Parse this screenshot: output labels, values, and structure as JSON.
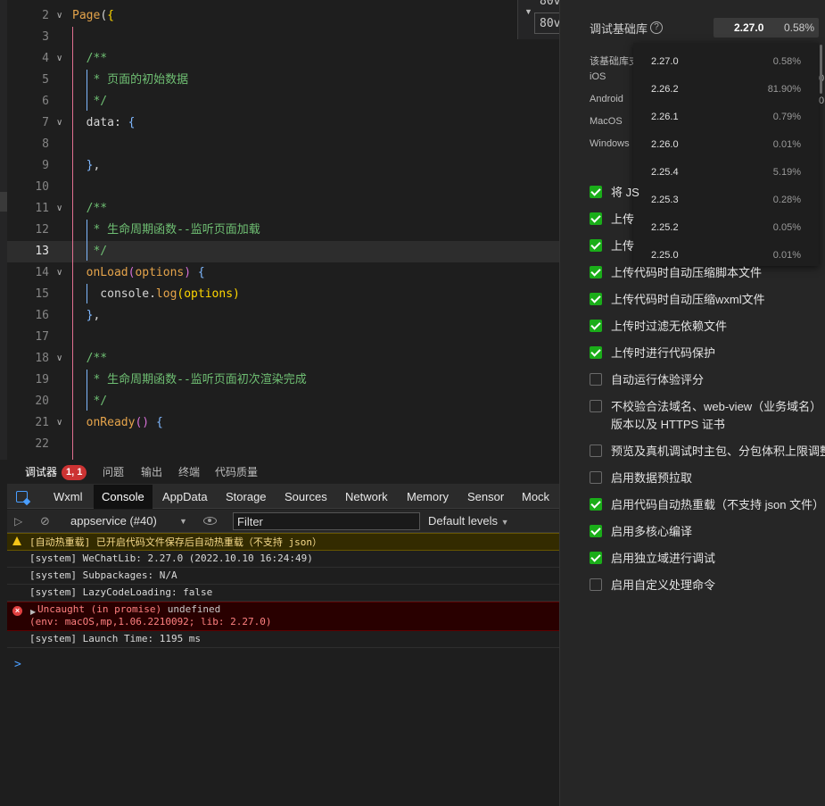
{
  "editor": {
    "lines": [
      {
        "num": "2",
        "fold": "chevron",
        "code": [
          [
            "Page",
            "kw"
          ],
          [
            "(",
            "brk"
          ],
          [
            "{",
            "ybr"
          ]
        ]
      },
      {
        "num": "3",
        "fold": "",
        "code": []
      },
      {
        "num": "4",
        "fold": "chevron",
        "code": [
          [
            "  /**",
            "cmt"
          ]
        ]
      },
      {
        "num": "5",
        "fold": "",
        "code": [
          [
            "   * 页面的初始数据",
            "cmt"
          ]
        ]
      },
      {
        "num": "6",
        "fold": "",
        "code": [
          [
            "   */",
            "cmt"
          ]
        ]
      },
      {
        "num": "7",
        "fold": "chevron",
        "code": [
          [
            "  data: ",
            "brk"
          ],
          [
            "{",
            "vbr"
          ]
        ]
      },
      {
        "num": "8",
        "fold": "",
        "code": []
      },
      {
        "num": "9",
        "fold": "",
        "code": [
          [
            "  ",
            "brk"
          ],
          [
            "}",
            "vbr"
          ],
          [
            ",",
            "brk"
          ]
        ]
      },
      {
        "num": "10",
        "fold": "",
        "code": []
      },
      {
        "num": "11",
        "fold": "chevron",
        "code": [
          [
            "  /**",
            "cmt"
          ]
        ]
      },
      {
        "num": "12",
        "fold": "",
        "code": [
          [
            "   * 生命周期函数--监听页面加载",
            "cmt"
          ]
        ]
      },
      {
        "num": "13",
        "fold": "",
        "code": [
          [
            "   */",
            "cmt"
          ]
        ],
        "active": true
      },
      {
        "num": "14",
        "fold": "chevron",
        "code": [
          [
            "  onLoad",
            "kw"
          ],
          [
            "(",
            "pbr"
          ],
          [
            "options",
            "arg"
          ],
          [
            ")",
            "pbr"
          ],
          [
            " ",
            "brk"
          ],
          [
            "{",
            "vbr"
          ]
        ]
      },
      {
        "num": "15",
        "fold": "",
        "code": [
          [
            "    console.",
            "brk"
          ],
          [
            "log",
            "kw"
          ],
          [
            "(options)",
            "ybr"
          ]
        ]
      },
      {
        "num": "16",
        "fold": "",
        "code": [
          [
            "  ",
            "brk"
          ],
          [
            "}",
            "vbr"
          ],
          [
            ",",
            "brk"
          ]
        ]
      },
      {
        "num": "17",
        "fold": "",
        "code": []
      },
      {
        "num": "18",
        "fold": "chevron",
        "code": [
          [
            "  /**",
            "cmt"
          ]
        ]
      },
      {
        "num": "19",
        "fold": "",
        "code": [
          [
            "   * 生命周期函数--监听页面初次渲染完成",
            "cmt"
          ]
        ]
      },
      {
        "num": "20",
        "fold": "",
        "code": [
          [
            "   */",
            "cmt"
          ]
        ]
      },
      {
        "num": "21",
        "fold": "chevron",
        "code": [
          [
            "  onReady",
            "kw"
          ],
          [
            "() ",
            "pbr"
          ],
          [
            "{",
            "vbr"
          ]
        ]
      },
      {
        "num": "22",
        "fold": "",
        "code": []
      }
    ],
    "tooltip": {
      "line1": "80v",
      "line2": "80v"
    }
  },
  "panel_tabs": [
    {
      "label": "调试器",
      "active": true
    },
    {
      "label": "问题"
    },
    {
      "label": "输出"
    },
    {
      "label": "终端"
    },
    {
      "label": "代码质量"
    }
  ],
  "debugger_badge": "1, 1",
  "devtools_tabs": [
    "Wxml",
    "Console",
    "AppData",
    "Storage",
    "Sources",
    "Network",
    "Memory",
    "Sensor",
    "Mock"
  ],
  "devtools_active_tab": "Console",
  "filterbar": {
    "context": "appservice (#40)",
    "filter_placeholder": "Filter",
    "levels": "Default levels"
  },
  "console": {
    "warning": "[自动热重载] 已开启代码文件保存后自动热重载（不支持 json）",
    "messages": [
      "[system] WeChatLib: 2.27.0 (2022.10.10 16:24:49)",
      "[system] Subpackages: N/A",
      "[system] LazyCodeLoading: false"
    ],
    "error_line1": "Uncaught (in promise)",
    "error_line1_suffix": " undefined",
    "error_line2": "(env: macOS,mp,1.06.2210092; lib: 2.27.0)",
    "launch": "[system] Launch Time: 1195 ms",
    "prompt": ">"
  },
  "settings": {
    "title": "调试基础库",
    "help": "?",
    "selected_version": "2.27.0",
    "selected_percent": "0.58%",
    "info_label": "该基础库支",
    "platforms": [
      "iOS",
      "Android",
      "MacOS",
      "Windows"
    ],
    "platform_right": [
      "0,",
      "0,"
    ],
    "versions": [
      {
        "v": "2.27.0",
        "p": "0.58%"
      },
      {
        "v": "2.26.2",
        "p": "81.90%"
      },
      {
        "v": "2.26.1",
        "p": "0.79%"
      },
      {
        "v": "2.26.0",
        "p": "0.01%"
      },
      {
        "v": "2.25.4",
        "p": "5.19%"
      },
      {
        "v": "2.25.3",
        "p": "0.28%"
      },
      {
        "v": "2.25.2",
        "p": "0.05%"
      },
      {
        "v": "2.25.0",
        "p": "0.01%"
      }
    ],
    "options": [
      {
        "label": "将 JS",
        "checked": true
      },
      {
        "label": "上传",
        "checked": true
      },
      {
        "label": "上传",
        "checked": true
      },
      {
        "label": "上传代码时自动压缩脚本文件",
        "checked": true
      },
      {
        "label": "上传代码时自动压缩wxml文件",
        "checked": true
      },
      {
        "label": "上传时过滤无依赖文件",
        "checked": true
      },
      {
        "label": "上传时进行代码保护",
        "checked": true
      },
      {
        "label": "自动运行体验评分",
        "checked": false
      },
      {
        "label": "不校验合法域名、web-view（业务域名）",
        "label2": "版本以及 HTTPS 证书",
        "checked": false
      },
      {
        "label": "预览及真机调试时主包、分包体积上限调整",
        "checked": false
      },
      {
        "label": "启用数据预拉取",
        "checked": false
      },
      {
        "label": "启用代码自动热重载（不支持 json 文件）",
        "checked": true
      },
      {
        "label": "启用多核心编译",
        "checked": true
      },
      {
        "label": "启用独立域进行调试",
        "checked": true
      },
      {
        "label": "启用自定义处理命令",
        "checked": false
      }
    ]
  }
}
